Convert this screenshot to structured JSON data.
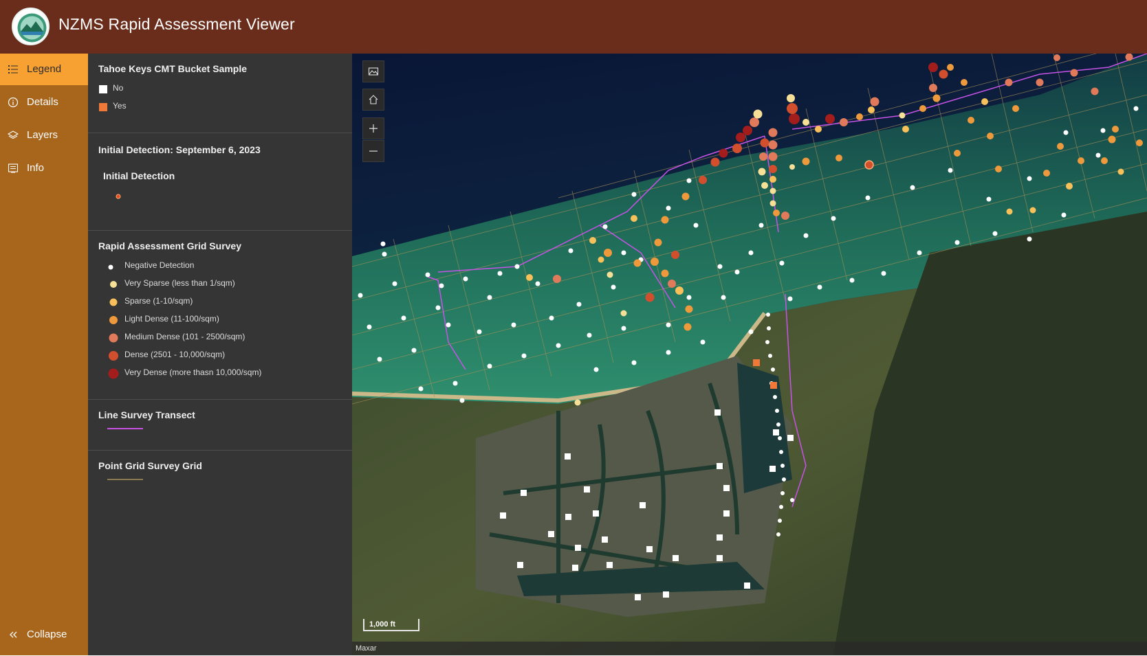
{
  "app": {
    "title": "NZMS Rapid Assessment Viewer",
    "header_color": "#6b2d1b",
    "logo": "agency-seal-logo"
  },
  "nav": {
    "items": [
      {
        "label": "Legend",
        "icon": "list-icon",
        "active": true
      },
      {
        "label": "Details",
        "icon": "info-circle-icon",
        "active": false
      },
      {
        "label": "Layers",
        "icon": "layers-icon",
        "active": false
      },
      {
        "label": "Info",
        "icon": "info-panel-icon",
        "active": false
      }
    ],
    "collapse_label": "Collapse",
    "collapse_icon": "double-chevron-left-icon",
    "accent_color": "#f7a133",
    "bar_color": "#a8651c"
  },
  "legend": {
    "bucket": {
      "title": "Tahoe Keys CMT Bucket Sample",
      "items": [
        {
          "label": "No",
          "color": "#ffffff"
        },
        {
          "label": "Yes",
          "color": "#f0793a"
        }
      ]
    },
    "initial": {
      "title": "Initial Detection: September 6, 2023",
      "subtitle": "Initial Detection",
      "color": "#e8471f"
    },
    "grid": {
      "title": "Rapid Assessment Grid Survey",
      "items": [
        {
          "label": "Negative Detection",
          "color": "#ffffff"
        },
        {
          "label": "Very Sparse (less than 1/sqm)",
          "color": "#f6df96"
        },
        {
          "label": "Sparse (1-10/sqm)",
          "color": "#f7c05a"
        },
        {
          "label": "Light Dense (11-100/sqm)",
          "color": "#ee9a3c"
        },
        {
          "label": "Medium Dense (101 - 2500/sqm)",
          "color": "#e07a5a"
        },
        {
          "label": "Dense (2501 - 10,000/sqm)",
          "color": "#d24f2e"
        },
        {
          "label": "Very Dense (more thasn 10,000/sqm)",
          "color": "#a31d1d"
        }
      ]
    },
    "transect": {
      "title": "Line Survey Transect",
      "color": "#c653e6"
    },
    "grid_lines": {
      "title": "Point Grid Survey Grid",
      "color": "#a89058"
    }
  },
  "map": {
    "controls": [
      {
        "name": "basemap-button",
        "icon": "basemap-icon"
      },
      {
        "name": "home-button",
        "icon": "home-icon"
      },
      {
        "name": "zoom-in-button",
        "icon": "plus-icon"
      },
      {
        "name": "zoom-out-button",
        "icon": "minus-icon"
      }
    ],
    "scale_label": "1,000 ft",
    "attribution": "Maxar"
  }
}
